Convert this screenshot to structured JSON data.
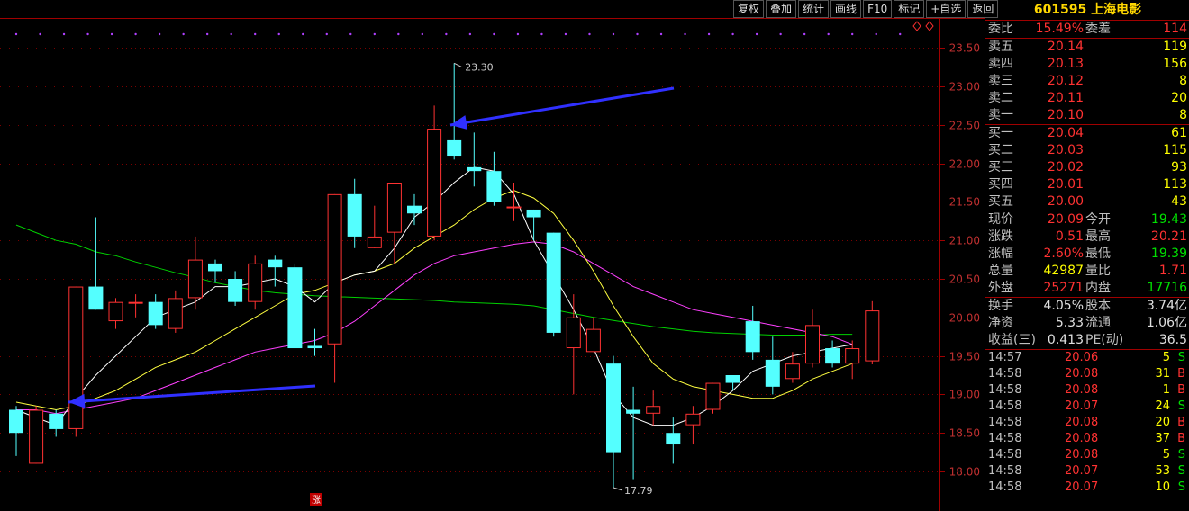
{
  "toolbar": [
    "复权",
    "叠加",
    "统计",
    "画线",
    "F10",
    "标记",
    "+自选",
    "返回"
  ],
  "stock": {
    "code": "601595",
    "name": "上海电影"
  },
  "weibi": {
    "label1": "委比",
    "value1": "15.49%",
    "label2": "委差",
    "value2": "114"
  },
  "asks": [
    {
      "label": "卖五",
      "price": "20.14",
      "vol": "119"
    },
    {
      "label": "卖四",
      "price": "20.13",
      "vol": "156"
    },
    {
      "label": "卖三",
      "price": "20.12",
      "vol": "8"
    },
    {
      "label": "卖二",
      "price": "20.11",
      "vol": "20"
    },
    {
      "label": "卖一",
      "price": "20.10",
      "vol": "8"
    }
  ],
  "bids": [
    {
      "label": "买一",
      "price": "20.04",
      "vol": "61"
    },
    {
      "label": "买二",
      "price": "20.03",
      "vol": "115"
    },
    {
      "label": "买三",
      "price": "20.02",
      "vol": "93"
    },
    {
      "label": "买四",
      "price": "20.01",
      "vol": "113"
    },
    {
      "label": "买五",
      "price": "20.00",
      "vol": "43"
    }
  ],
  "quote": [
    {
      "l1": "现价",
      "v1": "20.09",
      "c1": "red",
      "l2": "今开",
      "v2": "19.43",
      "c2": "grn"
    },
    {
      "l1": "涨跌",
      "v1": "0.51",
      "c1": "red",
      "l2": "最高",
      "v2": "20.21",
      "c2": "red"
    },
    {
      "l1": "涨幅",
      "v1": "2.60%",
      "c1": "red",
      "l2": "最低",
      "v2": "19.39",
      "c2": "grn"
    },
    {
      "l1": "总量",
      "v1": "42987",
      "c1": "yel",
      "l2": "量比",
      "v2": "1.71",
      "c2": "red"
    },
    {
      "l1": "外盘",
      "v1": "25271",
      "c1": "red",
      "l2": "内盘",
      "v2": "17716",
      "c2": "grn"
    }
  ],
  "fund": [
    {
      "l1": "换手",
      "v1": "4.05%",
      "l2": "股本",
      "v2": "3.74亿"
    },
    {
      "l1": "净资",
      "v1": "5.33",
      "l2": "流通",
      "v2": "1.06亿"
    },
    {
      "l1": "收益(三)",
      "v1": "0.413",
      "l2": "PE(动)",
      "v2": "36.5"
    }
  ],
  "ticks": [
    {
      "time": "14:57",
      "price": "20.06",
      "vol": "5",
      "flag": "S"
    },
    {
      "time": "14:58",
      "price": "20.08",
      "vol": "31",
      "flag": "B"
    },
    {
      "time": "14:58",
      "price": "20.08",
      "vol": "1",
      "flag": "B"
    },
    {
      "time": "14:58",
      "price": "20.07",
      "vol": "24",
      "flag": "S"
    },
    {
      "time": "14:58",
      "price": "20.08",
      "vol": "20",
      "flag": "B"
    },
    {
      "time": "14:58",
      "price": "20.08",
      "vol": "37",
      "flag": "B"
    },
    {
      "time": "14:58",
      "price": "20.08",
      "vol": "5",
      "flag": "S"
    },
    {
      "time": "14:58",
      "price": "20.07",
      "vol": "53",
      "flag": "S"
    },
    {
      "time": "14:58",
      "price": "20.07",
      "vol": "10",
      "flag": "S"
    }
  ],
  "chart_data": {
    "type": "candlestick",
    "ylim": [
      17.8,
      23.7
    ],
    "yticks": [
      "18.00",
      "18.50",
      "19.00",
      "19.50",
      "20.00",
      "20.50",
      "21.00",
      "21.50",
      "22.00",
      "22.50",
      "23.00",
      "23.50"
    ],
    "annotations": {
      "high": "23.30",
      "low": "17.79",
      "marker": "涨"
    },
    "colors": {
      "up": "#ff3232",
      "down": "#54ffff",
      "ma5": "#ffffff",
      "ma10": "#ffff40",
      "ma20": "#ff40ff",
      "ma60": "#00d000",
      "arrow": "#3030ff"
    },
    "candles": [
      {
        "o": 18.8,
        "c": 18.5,
        "h": 18.85,
        "l": 18.2
      },
      {
        "o": 18.1,
        "c": 18.8,
        "h": 18.85,
        "l": 18.1
      },
      {
        "o": 18.75,
        "c": 18.55,
        "h": 18.8,
        "l": 18.45
      },
      {
        "o": 18.55,
        "c": 20.4,
        "h": 20.4,
        "l": 18.45
      },
      {
        "o": 20.4,
        "c": 20.1,
        "h": 21.3,
        "l": 20.1
      },
      {
        "o": 19.95,
        "c": 20.2,
        "h": 20.25,
        "l": 19.85
      },
      {
        "o": 20.2,
        "c": 20.2,
        "h": 20.3,
        "l": 20.0
      },
      {
        "o": 20.2,
        "c": 19.9,
        "h": 20.3,
        "l": 19.85
      },
      {
        "o": 19.85,
        "c": 20.25,
        "h": 20.35,
        "l": 19.8
      },
      {
        "o": 20.25,
        "c": 20.75,
        "h": 21.05,
        "l": 20.1
      },
      {
        "o": 20.7,
        "c": 20.6,
        "h": 20.75,
        "l": 20.45
      },
      {
        "o": 20.5,
        "c": 20.2,
        "h": 20.6,
        "l": 20.15
      },
      {
        "o": 20.2,
        "c": 20.7,
        "h": 20.8,
        "l": 20.1
      },
      {
        "o": 20.75,
        "c": 20.65,
        "h": 20.8,
        "l": 20.4
      },
      {
        "o": 20.65,
        "c": 19.6,
        "h": 20.7,
        "l": 19.6
      },
      {
        "o": 19.63,
        "c": 19.6,
        "h": 19.85,
        "l": 19.5
      },
      {
        "o": 19.65,
        "c": 21.6,
        "h": 21.6,
        "l": 19.15
      },
      {
        "o": 21.6,
        "c": 21.05,
        "h": 21.8,
        "l": 20.9
      },
      {
        "o": 20.9,
        "c": 21.05,
        "h": 21.45,
        "l": 20.9
      },
      {
        "o": 21.1,
        "c": 21.75,
        "h": 21.75,
        "l": 20.7
      },
      {
        "o": 21.45,
        "c": 21.35,
        "h": 21.6,
        "l": 21.2
      },
      {
        "o": 21.05,
        "c": 22.45,
        "h": 22.75,
        "l": 21.0
      },
      {
        "o": 22.3,
        "c": 22.1,
        "h": 23.3,
        "l": 22.05
      },
      {
        "o": 21.95,
        "c": 21.9,
        "h": 22.4,
        "l": 21.7
      },
      {
        "o": 21.9,
        "c": 21.5,
        "h": 22.15,
        "l": 21.45
      },
      {
        "o": 21.44,
        "c": 21.44,
        "h": 21.75,
        "l": 21.25
      },
      {
        "o": 21.4,
        "c": 21.3,
        "h": 21.4,
        "l": 21.0
      },
      {
        "o": 21.1,
        "c": 19.8,
        "h": 21.1,
        "l": 19.75
      },
      {
        "o": 19.6,
        "c": 20.0,
        "h": 20.3,
        "l": 19.0
      },
      {
        "o": 19.55,
        "c": 19.85,
        "h": 20.0,
        "l": 19.55
      },
      {
        "o": 19.4,
        "c": 18.25,
        "h": 19.5,
        "l": 17.79
      },
      {
        "o": 18.8,
        "c": 18.75,
        "h": 19.1,
        "l": 17.9
      },
      {
        "o": 18.75,
        "c": 18.85,
        "h": 19.05,
        "l": 18.6
      },
      {
        "o": 18.5,
        "c": 18.35,
        "h": 18.7,
        "l": 18.1
      },
      {
        "o": 18.6,
        "c": 18.75,
        "h": 18.85,
        "l": 18.35
      },
      {
        "o": 18.8,
        "c": 19.15,
        "h": 19.15,
        "l": 18.75
      },
      {
        "o": 19.25,
        "c": 19.15,
        "h": 19.25,
        "l": 19.05
      },
      {
        "o": 19.95,
        "c": 19.55,
        "h": 20.15,
        "l": 19.45
      },
      {
        "o": 19.45,
        "c": 19.1,
        "h": 19.75,
        "l": 19.0
      },
      {
        "o": 19.2,
        "c": 19.4,
        "h": 19.55,
        "l": 19.15
      },
      {
        "o": 19.4,
        "c": 19.9,
        "h": 20.1,
        "l": 19.35
      },
      {
        "o": 19.6,
        "c": 19.4,
        "h": 19.7,
        "l": 19.35
      },
      {
        "o": 19.4,
        "c": 19.6,
        "h": 19.7,
        "l": 19.2
      },
      {
        "o": 19.43,
        "c": 20.09,
        "h": 20.21,
        "l": 19.39
      }
    ],
    "ma5": [
      18.8,
      18.7,
      18.6,
      18.95,
      19.25,
      19.5,
      19.75,
      20.0,
      20.1,
      20.2,
      20.4,
      20.4,
      20.45,
      20.5,
      20.4,
      20.2,
      20.45,
      20.55,
      20.6,
      20.9,
      21.3,
      21.5,
      21.75,
      21.95,
      21.9,
      21.6,
      21.0,
      20.55,
      20.1,
      19.6,
      19.0,
      18.7,
      18.6,
      18.6,
      18.7,
      18.85,
      19.05,
      19.3,
      19.4,
      19.5,
      19.55,
      19.6,
      19.65
    ],
    "ma10": [
      18.9,
      18.85,
      18.8,
      18.85,
      18.95,
      19.05,
      19.2,
      19.35,
      19.45,
      19.55,
      19.7,
      19.85,
      20.0,
      20.15,
      20.3,
      20.35,
      20.45,
      20.55,
      20.6,
      20.7,
      20.9,
      21.05,
      21.2,
      21.4,
      21.55,
      21.65,
      21.55,
      21.35,
      21.0,
      20.6,
      20.15,
      19.75,
      19.4,
      19.2,
      19.1,
      19.05,
      19.0,
      18.95,
      18.95,
      19.05,
      19.2,
      19.3,
      19.4
    ],
    "ma20": [
      18.8,
      18.8,
      18.75,
      18.8,
      18.85,
      18.9,
      18.95,
      19.05,
      19.15,
      19.25,
      19.35,
      19.45,
      19.55,
      19.6,
      19.65,
      19.7,
      19.8,
      19.95,
      20.15,
      20.35,
      20.55,
      20.7,
      20.8,
      20.85,
      20.9,
      20.95,
      20.98,
      20.95,
      20.85,
      20.7,
      20.55,
      20.4,
      20.3,
      20.2,
      20.1,
      20.05,
      20.0,
      19.95,
      19.9,
      19.85,
      19.8,
      19.75,
      19.65
    ],
    "ma60": [
      21.2,
      21.1,
      21.0,
      20.95,
      20.85,
      20.8,
      20.72,
      20.65,
      20.58,
      20.52,
      20.45,
      20.4,
      20.35,
      20.32,
      20.3,
      20.28,
      20.27,
      20.26,
      20.25,
      20.24,
      20.23,
      20.22,
      20.2,
      20.19,
      20.18,
      20.17,
      20.15,
      20.1,
      20.05,
      20.0,
      19.96,
      19.92,
      19.88,
      19.85,
      19.82,
      19.8,
      19.79,
      19.78,
      19.77,
      19.77,
      19.77,
      19.78,
      19.78
    ]
  }
}
